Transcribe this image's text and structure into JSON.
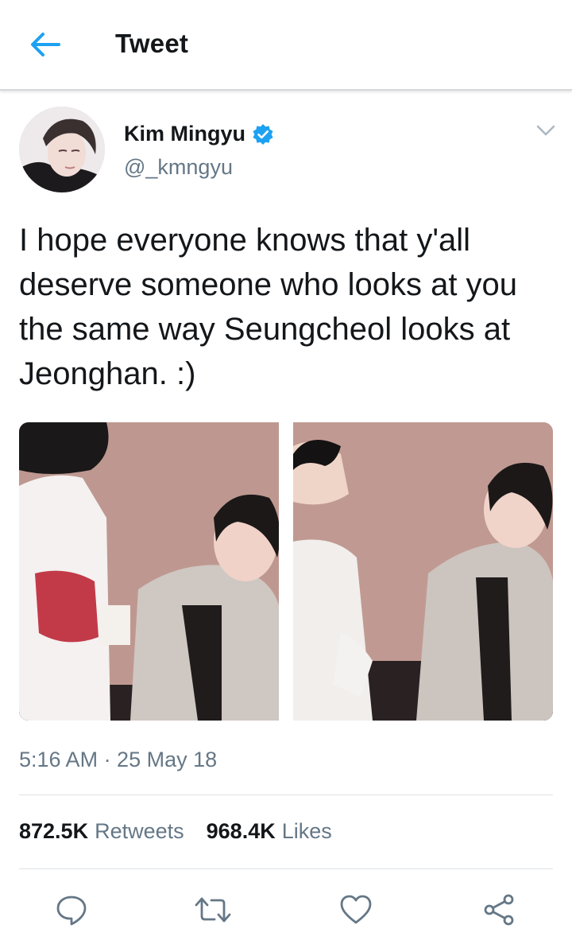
{
  "header": {
    "title": "Tweet",
    "back_icon": "arrow-left-icon"
  },
  "author": {
    "name": "Kim Mingyu",
    "handle": "@_kmngyu",
    "verified": true
  },
  "tweet": {
    "text": "I hope everyone knows that y'all deserve someone who looks at you the same way Seungcheol looks at Jeonghan. :)",
    "timestamp": "5:16 AM · 25 May 18"
  },
  "stats": {
    "retweets_count": "872.5K",
    "retweets_label": "Retweets",
    "likes_count": "968.4K",
    "likes_label": "Likes"
  },
  "actions": [
    "reply-icon",
    "retweet-icon",
    "like-icon",
    "share-icon"
  ],
  "colors": {
    "accent": "#1da1f2",
    "secondary_text": "#657786",
    "divider": "#dde2e6"
  }
}
